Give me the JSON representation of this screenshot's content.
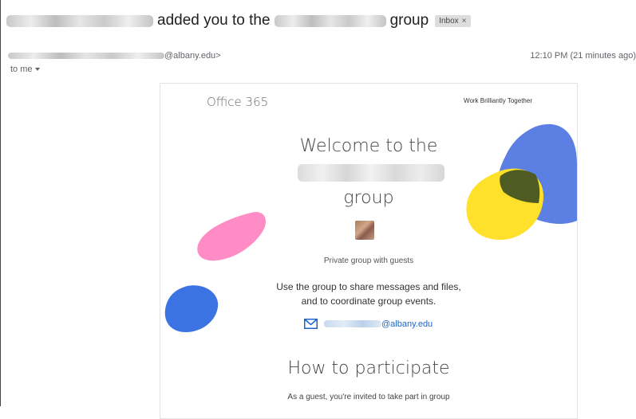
{
  "subject": {
    "text_a": "added you to the",
    "text_b": "group",
    "badge": "Inbox",
    "badge_close": "×"
  },
  "sender": {
    "email_suffix": "@albany.edu>",
    "time": "12:10 PM (21 minutes ago)",
    "to": "to me"
  },
  "email": {
    "brand": "Office 365",
    "tagline": "Work Brilliantly Together",
    "welcome_line1": "Welcome to the",
    "welcome_line3": "group",
    "privacy": "Private group with guests",
    "desc_line1": "Use the group to share messages and files,",
    "desc_line2": "and to coordinate group events.",
    "group_email_suffix": "@albany.edu",
    "how_title": "How to participate",
    "guest_text": "As a guest, you're invited to take part in group"
  },
  "colors": {
    "blue": "#5B7FE3",
    "yellow": "#FFE02A",
    "olive": "#4E5C24",
    "pink": "#FF8CC4",
    "blue_blob": "#3B73E2",
    "link": "#1E66C8"
  },
  "icons": {
    "mail": "envelope-icon",
    "caret": "caret-down-icon"
  }
}
